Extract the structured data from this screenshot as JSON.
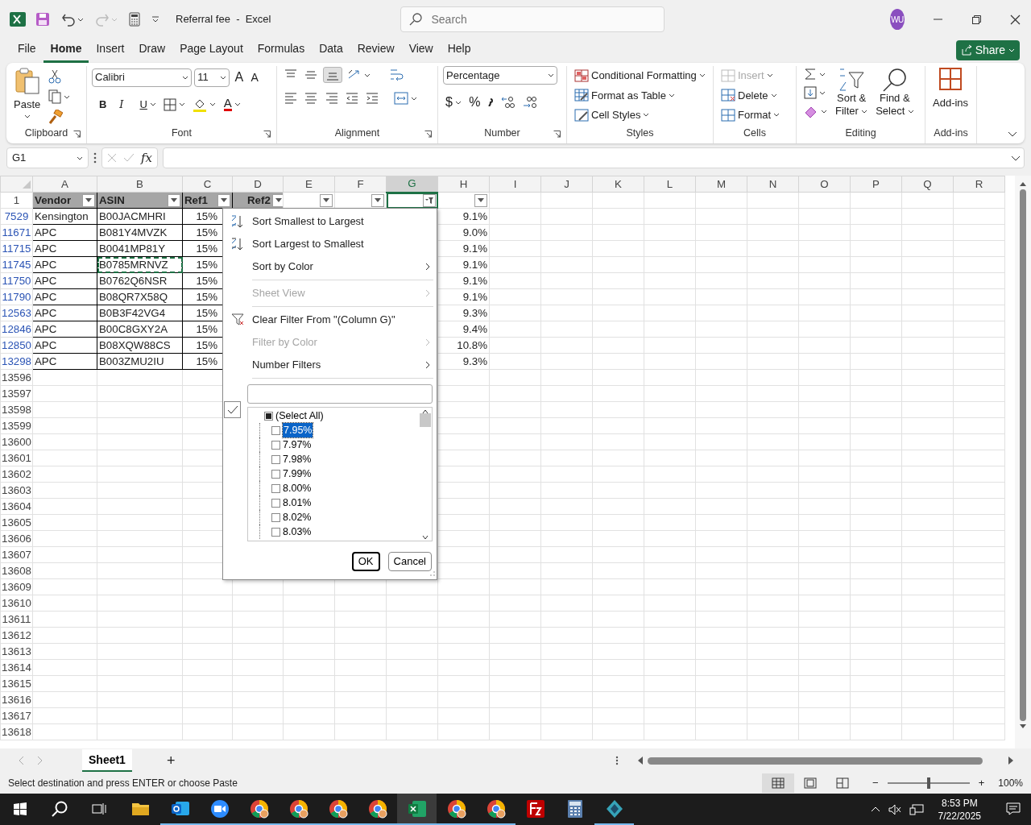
{
  "title_bar": {
    "title": "Referral fee  -  Excel",
    "search_placeholder": "Search",
    "avatar": "WU",
    "redo_disabled": true
  },
  "ribbon_tabs": [
    {
      "label": "File",
      "selected": false
    },
    {
      "label": "Home",
      "selected": true
    },
    {
      "label": "Insert",
      "selected": false
    },
    {
      "label": "Draw",
      "selected": false
    },
    {
      "label": "Page Layout",
      "selected": false
    },
    {
      "label": "Formulas",
      "selected": false
    },
    {
      "label": "Data",
      "selected": false
    },
    {
      "label": "Review",
      "selected": false
    },
    {
      "label": "View",
      "selected": false
    },
    {
      "label": "Help",
      "selected": false
    }
  ],
  "share_button": "Share",
  "ribbon": {
    "clipboard": {
      "paste": "Paste",
      "label": "Clipboard"
    },
    "font": {
      "name": "Calibri",
      "size": "11",
      "grow": "A",
      "shrink": "A",
      "bold": "B",
      "italic": "I",
      "underline": "U",
      "font_color": "A",
      "label": "Font"
    },
    "alignment": {
      "label": "Alignment",
      "bottom_align_selected": true
    },
    "number": {
      "format": "Percentage",
      "currency": "$",
      "percent": "%",
      "label": "Number"
    },
    "styles": {
      "items": [
        "Conditional Formatting",
        "Format as Table",
        "Cell Styles"
      ],
      "label": "Styles"
    },
    "cells": {
      "items": [
        {
          "label": "Insert",
          "disabled": true
        },
        {
          "label": "Delete",
          "disabled": false
        },
        {
          "label": "Format",
          "disabled": false
        }
      ],
      "label": "Cells"
    },
    "editing": {
      "sort_filter": [
        "Sort &",
        "Filter"
      ],
      "find_select": [
        "Find &",
        "Select"
      ],
      "label": "Editing"
    },
    "addins": {
      "button": "Add-ins",
      "label": "Add-ins"
    }
  },
  "formula_bar": {
    "name_box": "G1",
    "fx": "fx"
  },
  "header_row_number": "1",
  "columns": [
    {
      "letter": "A",
      "header": "Vendor",
      "filter_button": true,
      "filter_applied": false,
      "selected": false
    },
    {
      "letter": "B",
      "header": "ASIN",
      "filter_button": true,
      "filter_applied": false,
      "selected": false
    },
    {
      "letter": "C",
      "header": "Ref1",
      "filter_button": true,
      "filter_applied": false,
      "selected": false
    },
    {
      "letter": "D",
      "header": "Ref2",
      "filter_button": true,
      "filter_applied": false,
      "selected": false
    },
    {
      "letter": "E",
      "filter_button": true,
      "filter_applied": false,
      "selected": false
    },
    {
      "letter": "F",
      "filter_button": true,
      "filter_applied": false,
      "selected": false
    },
    {
      "letter": "G",
      "filter_button": true,
      "filter_applied": true,
      "selected": true
    },
    {
      "letter": "H",
      "filter_button": true,
      "filter_applied": false,
      "selected": false
    },
    {
      "letter": "I",
      "filter_button": false,
      "selected": false
    },
    {
      "letter": "J",
      "filter_button": false,
      "selected": false
    },
    {
      "letter": "K",
      "filter_button": false,
      "selected": false
    },
    {
      "letter": "L",
      "filter_button": false,
      "selected": false
    },
    {
      "letter": "M",
      "filter_button": false,
      "selected": false
    },
    {
      "letter": "N",
      "filter_button": false,
      "selected": false
    },
    {
      "letter": "O",
      "filter_button": false,
      "selected": false
    },
    {
      "letter": "P",
      "filter_button": false,
      "selected": false
    },
    {
      "letter": "Q",
      "filter_button": false,
      "selected": false
    },
    {
      "letter": "R",
      "filter_button": false,
      "selected": false
    }
  ],
  "rows": [
    {
      "number": "7529",
      "filtered": true,
      "vendor": "Kensington",
      "asin": "B00JACMHRI",
      "ref1": "15%",
      "column_h": "9.1%",
      "marquee": false
    },
    {
      "number": "11671",
      "filtered": true,
      "vendor": "APC",
      "asin": "B081Y4MVZK",
      "ref1": "15%",
      "column_h": "9.0%",
      "marquee": false
    },
    {
      "number": "11715",
      "filtered": true,
      "vendor": "APC",
      "asin": "B0041MP81Y",
      "ref1": "15%",
      "column_h": "9.1%",
      "marquee": false
    },
    {
      "number": "11745",
      "filtered": true,
      "vendor": "APC",
      "asin": "B0785MRNVZ",
      "ref1": "15%",
      "column_h": "9.1%",
      "marquee": true
    },
    {
      "number": "11750",
      "filtered": true,
      "vendor": "APC",
      "asin": "B0762Q6NSR",
      "ref1": "15%",
      "column_h": "9.1%",
      "marquee": false
    },
    {
      "number": "11790",
      "filtered": true,
      "vendor": "APC",
      "asin": "B08QR7X58Q",
      "ref1": "15%",
      "column_h": "9.1%",
      "marquee": false
    },
    {
      "number": "12563",
      "filtered": true,
      "vendor": "APC",
      "asin": "B0B3F42VG4",
      "ref1": "15%",
      "column_h": "9.3%",
      "marquee": false
    },
    {
      "number": "12846",
      "filtered": true,
      "vendor": "APC",
      "asin": "B00C8GXY2A",
      "ref1": "15%",
      "column_h": "9.4%",
      "marquee": false
    },
    {
      "number": "12850",
      "filtered": true,
      "vendor": "APC",
      "asin": "B08XQW88CS",
      "ref1": "15%",
      "column_h": "10.8%",
      "marquee": false
    },
    {
      "number": "13298",
      "filtered": true,
      "vendor": "APC",
      "asin": "B003ZMU2IU",
      "ref1": "15%",
      "column_h": "9.3%",
      "marquee": false
    },
    {
      "number": "13596",
      "filtered": false
    },
    {
      "number": "13597",
      "filtered": false
    },
    {
      "number": "13598",
      "filtered": false
    },
    {
      "number": "13599",
      "filtered": false
    },
    {
      "number": "13600",
      "filtered": false
    },
    {
      "number": "13601",
      "filtered": false
    },
    {
      "number": "13602",
      "filtered": false
    },
    {
      "number": "13603",
      "filtered": false
    },
    {
      "number": "13604",
      "filtered": false
    },
    {
      "number": "13605",
      "filtered": false
    },
    {
      "number": "13606",
      "filtered": false
    },
    {
      "number": "13607",
      "filtered": false
    },
    {
      "number": "13608",
      "filtered": false
    },
    {
      "number": "13609",
      "filtered": false
    },
    {
      "number": "13610",
      "filtered": false
    },
    {
      "number": "13611",
      "filtered": false
    },
    {
      "number": "13612",
      "filtered": false
    },
    {
      "number": "13613",
      "filtered": false
    },
    {
      "number": "13614",
      "filtered": false
    },
    {
      "number": "13615",
      "filtered": false
    },
    {
      "number": "13616",
      "filtered": false
    },
    {
      "number": "13617",
      "filtered": false
    },
    {
      "number": "13618",
      "filtered": false
    }
  ],
  "filter_menu": {
    "items": [
      {
        "kind": "sort_ascending",
        "label": "Sort Smallest to Largest",
        "disabled": false,
        "submenu": false
      },
      {
        "kind": "sort_descending",
        "label": "Sort Largest to Smallest",
        "disabled": false,
        "submenu": false
      },
      {
        "kind": "plain",
        "label": "Sort by Color",
        "disabled": false,
        "submenu": true
      },
      {
        "kind": "separator"
      },
      {
        "kind": "plain",
        "label": "Sheet View",
        "disabled": true,
        "submenu": true
      },
      {
        "kind": "separator"
      },
      {
        "kind": "clear_filter",
        "label": "Clear Filter From \"(Column G)\"",
        "disabled": false,
        "submenu": false
      },
      {
        "kind": "plain",
        "label": "Filter by Color",
        "disabled": true,
        "submenu": true
      },
      {
        "kind": "plain",
        "label": "Number Filters",
        "disabled": false,
        "submenu": true
      },
      {
        "kind": "separator"
      }
    ],
    "side_checkbox_checked": true,
    "values": [
      {
        "label": "(Select All)",
        "checked": false,
        "indeterminate": true,
        "selected": false
      },
      {
        "label": "7.95%",
        "checked": false,
        "indeterminate": false,
        "selected": true
      },
      {
        "label": "7.97%",
        "checked": false,
        "indeterminate": false,
        "selected": false
      },
      {
        "label": "7.98%",
        "checked": false,
        "indeterminate": false,
        "selected": false
      },
      {
        "label": "7.99%",
        "checked": false,
        "indeterminate": false,
        "selected": false
      },
      {
        "label": "8.00%",
        "checked": false,
        "indeterminate": false,
        "selected": false
      },
      {
        "label": "8.01%",
        "checked": false,
        "indeterminate": false,
        "selected": false
      },
      {
        "label": "8.02%",
        "checked": false,
        "indeterminate": false,
        "selected": false
      },
      {
        "label": "8.03%",
        "checked": false,
        "indeterminate": false,
        "selected": false
      }
    ],
    "ok_button": "OK",
    "cancel_button": "Cancel"
  },
  "sheet_tabs": [
    {
      "label": "Sheet1",
      "selected": true
    }
  ],
  "add_sheet": "+",
  "status_bar": {
    "message": "Select destination and press ENTER or choose Paste",
    "views": [
      {
        "kind": "normal",
        "selected": true
      },
      {
        "kind": "page_layout",
        "selected": false
      },
      {
        "kind": "page_break",
        "selected": false
      }
    ],
    "zoom_out": "−",
    "zoom_in": "+",
    "zoom_slider": {
      "level": 0.5
    },
    "zoom": "100%"
  },
  "taskbar": {
    "items": [
      {
        "kind": "explorer",
        "active": false,
        "running": false
      },
      {
        "kind": "outlook",
        "active": false,
        "running": true
      },
      {
        "kind": "zoom",
        "active": false,
        "running": true
      },
      {
        "kind": "chrome",
        "active": false,
        "running": true
      },
      {
        "kind": "chrome",
        "active": false,
        "running": true
      },
      {
        "kind": "chrome",
        "active": false,
        "running": true
      },
      {
        "kind": "chrome",
        "active": false,
        "running": true
      },
      {
        "kind": "excel",
        "active": true,
        "running": true
      },
      {
        "kind": "chrome",
        "active": false,
        "running": true
      },
      {
        "kind": "chrome",
        "active": false,
        "running": true
      },
      {
        "kind": "filezilla",
        "active": false,
        "running": false
      },
      {
        "kind": "calculator",
        "active": false,
        "running": false
      },
      {
        "kind": "app",
        "active": false,
        "running": true
      }
    ],
    "time": "8:53 PM",
    "date": "7/22/2025"
  }
}
